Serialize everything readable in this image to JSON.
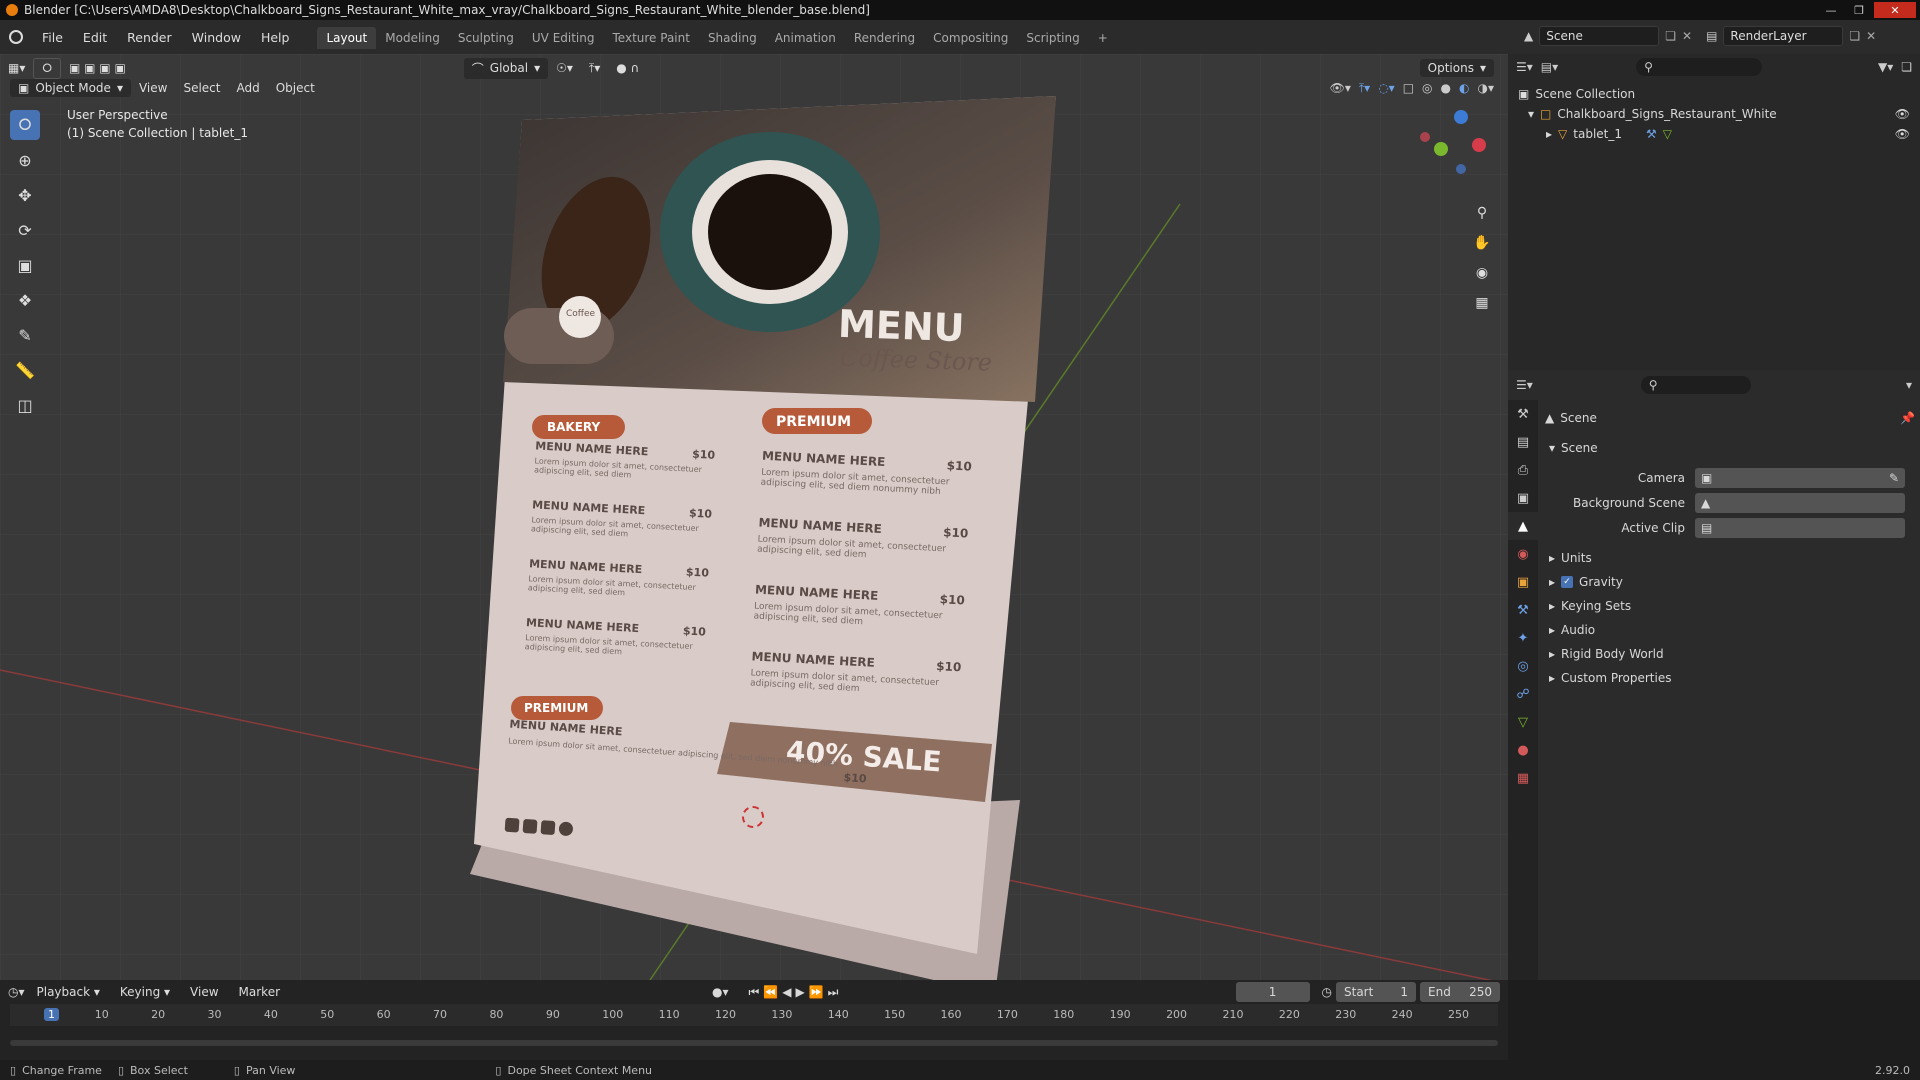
{
  "titlebar": {
    "title": "Blender [C:\\Users\\AMDA8\\Desktop\\Chalkboard_Signs_Restaurant_White_max_vray/Chalkboard_Signs_Restaurant_White_blender_base.blend]"
  },
  "menu": [
    "File",
    "Edit",
    "Render",
    "Window",
    "Help"
  ],
  "workspaces": [
    "Layout",
    "Modeling",
    "Sculpting",
    "UV Editing",
    "Texture Paint",
    "Shading",
    "Animation",
    "Rendering",
    "Compositing",
    "Scripting"
  ],
  "scene_field": "Scene",
  "renderlayer_field": "RenderLayer",
  "viewport": {
    "mode": "Object Mode",
    "menus": [
      "View",
      "Select",
      "Add",
      "Object"
    ],
    "orientation": "Global",
    "options": "Options",
    "overlay_line1": "User Perspective",
    "overlay_line2": "(1) Scene Collection | tablet_1"
  },
  "menu_card": {
    "title": "MENU",
    "subtitle": "Coffee Store",
    "coffee_badge": "Coffee",
    "bakery": "BAKERY",
    "premium1": "PREMIUM",
    "premium2": "PREMIUM",
    "item": "MENU NAME HERE",
    "price": "$10",
    "lorem": "Lorem ipsum dolor sit amet, consectetuer adipiscing elit, sed diem nonummy nibh",
    "lorem_short": "Lorem ipsum dolor sit amet, consectetuer adipiscing elit, sed diem",
    "sale": "40% SALE"
  },
  "outliner": {
    "root": "Scene Collection",
    "collection": "Chalkboard_Signs_Restaurant_White",
    "object": "tablet_1"
  },
  "properties": {
    "header": "Scene",
    "panel": "Scene",
    "camera_label": "Camera",
    "bg_label": "Background Scene",
    "clip_label": "Active Clip",
    "sections": [
      "Units",
      "Gravity",
      "Keying Sets",
      "Audio",
      "Rigid Body World",
      "Custom Properties"
    ]
  },
  "timeline": {
    "menus": [
      "Playback",
      "Keying",
      "View",
      "Marker"
    ],
    "current_frame": "1",
    "start_label": "Start",
    "start": "1",
    "end_label": "End",
    "end": "250",
    "ticks": [
      "1",
      "10",
      "20",
      "30",
      "40",
      "50",
      "60",
      "70",
      "80",
      "90",
      "100",
      "110",
      "120",
      "130",
      "140",
      "150",
      "160",
      "170",
      "180",
      "190",
      "200",
      "210",
      "220",
      "230",
      "240",
      "250"
    ]
  },
  "status": {
    "items": [
      "Change Frame",
      "Box Select",
      "Pan View",
      "Dope Sheet Context Menu"
    ],
    "version": "2.92.0"
  }
}
